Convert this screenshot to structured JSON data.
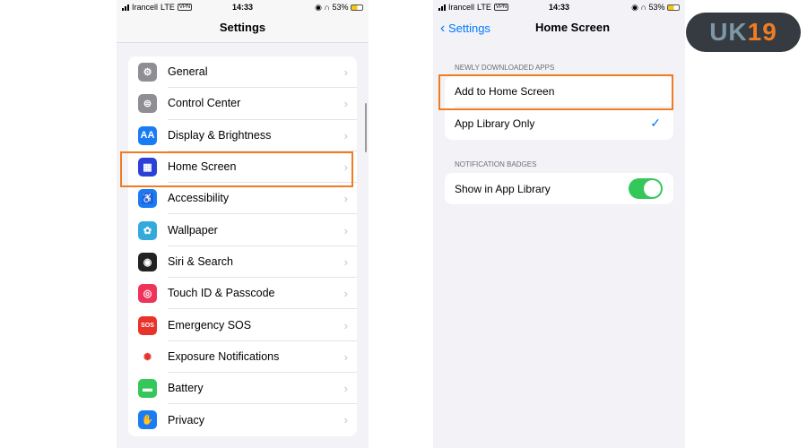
{
  "status": {
    "carrier": "Irancell",
    "network": "LTE",
    "vpn": "VPN",
    "time": "14:33",
    "battery": "53%"
  },
  "left": {
    "title": "Settings",
    "items": [
      {
        "label": "General",
        "icon": "gear-icon",
        "color": "#8e8e93",
        "glyph": "⚙"
      },
      {
        "label": "Control Center",
        "icon": "toggles-icon",
        "color": "#8e8e93",
        "glyph": "⊜"
      },
      {
        "label": "Display & Brightness",
        "icon": "text-size-icon",
        "color": "#1a7cf5",
        "glyph": "AA"
      },
      {
        "label": "Home Screen",
        "icon": "home-grid-icon",
        "color": "#2c3fd6",
        "glyph": "▦"
      },
      {
        "label": "Accessibility",
        "icon": "accessibility-icon",
        "color": "#1a7cf5",
        "glyph": "♿"
      },
      {
        "label": "Wallpaper",
        "icon": "flower-icon",
        "color": "#33aadc",
        "glyph": "✿"
      },
      {
        "label": "Siri & Search",
        "icon": "siri-icon",
        "color": "#222",
        "glyph": "◉"
      },
      {
        "label": "Touch ID & Passcode",
        "icon": "fingerprint-icon",
        "color": "#f0335a",
        "glyph": "◎"
      },
      {
        "label": "Emergency SOS",
        "icon": "sos-icon",
        "color": "#e8332b",
        "glyph": "SOS"
      },
      {
        "label": "Exposure Notifications",
        "icon": "exposure-icon",
        "color": "#ffffff",
        "glyph": "✺"
      },
      {
        "label": "Battery",
        "icon": "battery-icon",
        "color": "#34c759",
        "glyph": "▬"
      },
      {
        "label": "Privacy",
        "icon": "hand-icon",
        "color": "#1a7cf5",
        "glyph": "✋"
      }
    ]
  },
  "right": {
    "back": "Settings",
    "title": "Home Screen",
    "section1": "NEWLY DOWNLOADED APPS",
    "opt1": "Add to Home Screen",
    "opt2": "App Library Only",
    "section2": "NOTIFICATION BADGES",
    "toggle_label": "Show in App Library",
    "toggle_on": true,
    "selected": "App Library Only"
  },
  "logo": {
    "text_a": "UK",
    "text_b": "19"
  },
  "colors": {
    "highlight": "#f07c22",
    "accent": "#007aff",
    "toggle": "#34c759"
  }
}
